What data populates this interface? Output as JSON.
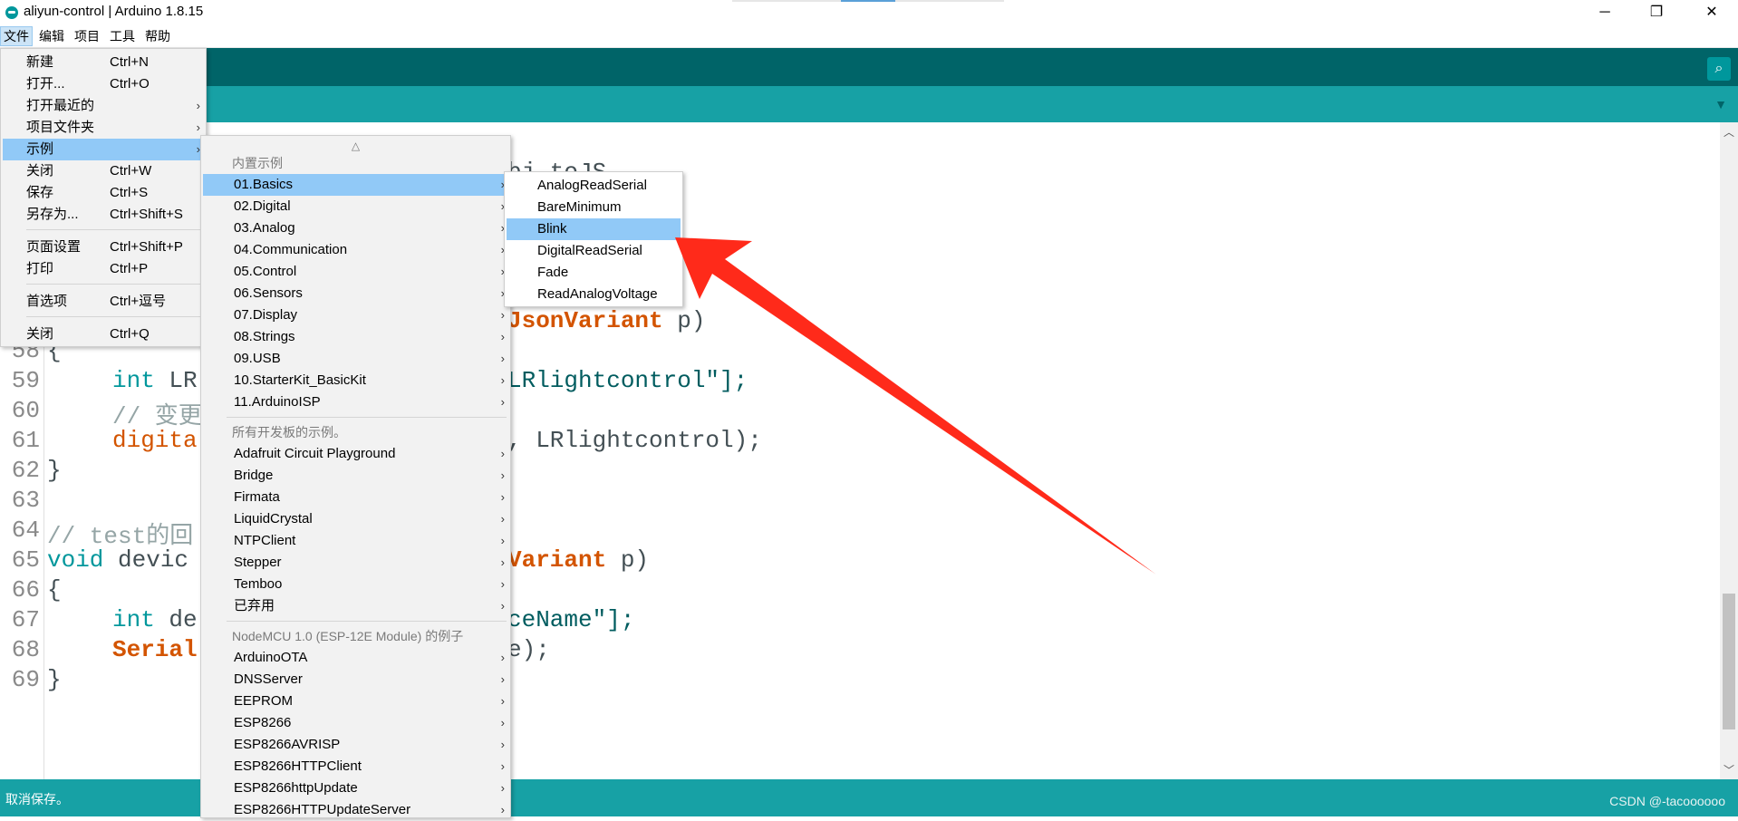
{
  "window": {
    "title": "aliyun-control | Arduino 1.8.15",
    "minimize": "─",
    "restore": "❐",
    "close": "✕"
  },
  "menubar": [
    "文件",
    "编辑",
    "项目",
    "工具",
    "帮助"
  ],
  "file_menu": {
    "items": [
      {
        "label": "新建",
        "shortcut": "Ctrl+N"
      },
      {
        "label": "打开...",
        "shortcut": "Ctrl+O"
      },
      {
        "label": "打开最近的",
        "shortcut": "",
        "submenu": true
      },
      {
        "label": "项目文件夹",
        "shortcut": "",
        "submenu": true
      },
      {
        "label": "示例",
        "shortcut": "",
        "submenu": true
      },
      {
        "label": "关闭",
        "shortcut": "Ctrl+W"
      },
      {
        "label": "保存",
        "shortcut": "Ctrl+S"
      },
      {
        "label": "另存为...",
        "shortcut": "Ctrl+Shift+S"
      },
      {
        "label": "页面设置",
        "shortcut": "Ctrl+Shift+P"
      },
      {
        "label": "打印",
        "shortcut": "Ctrl+P"
      },
      {
        "label": "首选项",
        "shortcut": "Ctrl+逗号"
      },
      {
        "label": "关闭",
        "shortcut": "Ctrl+Q"
      }
    ]
  },
  "examples_menu": {
    "scroll_up": "△",
    "builtin_header": "内置示例",
    "builtin": [
      "01.Basics",
      "02.Digital",
      "03.Analog",
      "04.Communication",
      "05.Control",
      "06.Sensors",
      "07.Display",
      "08.Strings",
      "09.USB",
      "10.StarterKit_BasicKit",
      "11.ArduinoISP"
    ],
    "all_boards_header": "所有开发板的示例。",
    "all_boards": [
      "Adafruit Circuit Playground",
      "Bridge",
      "Firmata",
      "LiquidCrystal",
      "NTPClient",
      "Stepper",
      "Temboo",
      "已弃用"
    ],
    "board_header": "NodeMCU 1.0 (ESP-12E Module) 的例子",
    "board": [
      "ArduinoOTA",
      "DNSServer",
      "EEPROM",
      "ESP8266",
      "ESP8266AVRISP",
      "ESP8266HTTPClient",
      "ESP8266httpUpdate",
      "ESP8266HTTPUpdateServer"
    ]
  },
  "basics_menu": {
    "items": [
      "AnalogReadSerial",
      "BareMinimum",
      "Blink",
      "DigitalReadSerial",
      "Fade",
      "ReadAnalogVoltage"
    ]
  },
  "editor": {
    "line_numbers": [
      "58",
      "59",
      "60",
      "61",
      "62",
      "63",
      "64",
      "65",
      "66",
      "67",
      "68",
      "69"
    ],
    "code": {
      "l58": "{",
      "l59_kw": "int",
      "l59_rest": " LR",
      "l60": "// 变更",
      "l61_fn": "digita",
      "l62": "}",
      "l64": "// test的回",
      "l65_kw": "void",
      "l65_rest": " devic",
      "l66": "{",
      "l67_kw": "int",
      "l67_rest": " de",
      "l68_fn": "Serial",
      "l69": "}"
    },
    "right_fragments": {
      "f_top": "bj.toJS",
      "f_json": "JsonVariant",
      "f_p": " p)",
      "f_str": "LRlightcontrol\"];",
      "f_call": ", LRlightcontrol);",
      "f_variant": "Variant",
      "f_p2": " p)",
      "f_name": "ceName\"];",
      "f_e": "e);"
    }
  },
  "status": {
    "text": "取消保存。",
    "watermark": "CSDN @-tacoooooo"
  },
  "icons": {
    "serial_monitor": "⌕",
    "tab_menu": "▼",
    "scroll_up": "︿",
    "scroll_down": "﹀",
    "submenu_arrow": "›"
  },
  "colors": {
    "toolbar": "#006468",
    "tabbar": "#17a1a5",
    "highlight": "#91c9f7",
    "keyword": "#00979c",
    "function": "#d35400",
    "arrow": "#ff2a1a"
  }
}
